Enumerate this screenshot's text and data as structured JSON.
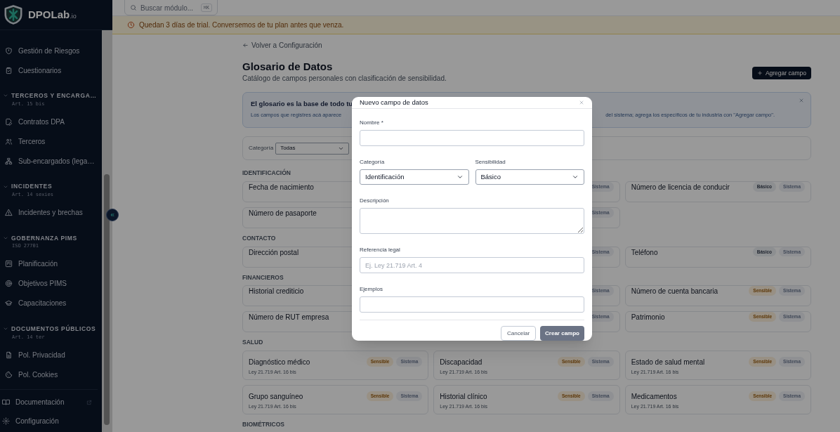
{
  "brand": {
    "name": "DPOLab",
    "suffix": ".io"
  },
  "search": {
    "placeholder": "Buscar módulo...",
    "shortcut": "⌘K"
  },
  "trial_banner": "Quedan 3 días de trial. Conversemos de tu plan antes que venza.",
  "sidebar": {
    "groups": [
      {
        "items": [
          "Gestión de Riesgos",
          "Cuestionarios"
        ]
      },
      {
        "title": "TERCEROS Y ENCARGA…",
        "subtitle": "Art. 15 bis",
        "expanded": true,
        "items": [
          "Contratos DPA",
          "Terceros",
          "Sub-encargados (lega…"
        ]
      },
      {
        "title": "INCIDENTES",
        "subtitle": "Art. 14 sexies",
        "expanded": true,
        "items": [
          "Incidentes y brechas"
        ]
      },
      {
        "title": "GOBERNANZA PIMS",
        "subtitle": "ISO 27701",
        "expanded": true,
        "items": [
          "Planificación",
          "Objetivos PIMS",
          "Capacitaciones"
        ]
      },
      {
        "title": "DOCUMENTOS PÚBLICOS",
        "subtitle": "Art. 14 ter",
        "expanded": true,
        "items": [
          "Pol. Privacidad",
          "Pol. Cookies"
        ]
      }
    ],
    "footer": [
      "Documentación",
      "Configuración"
    ]
  },
  "back_link": "Volver a Configuración",
  "page": {
    "title": "Glosario de Datos",
    "subtitle": "Catálogo de campos personales con clasificación de sensibilidad.",
    "add_button": "Agregar campo"
  },
  "info": {
    "title": "El glosario es la base de todo tu",
    "text_left": "Los campos que registres acá aparece",
    "text_right": "del sistema; agrega los específicos de tu industria con \"Agregar campo\"."
  },
  "filter": {
    "label": "Categoría",
    "value": "Todas"
  },
  "categories": [
    {
      "name": "IDENTIFICACIÓN",
      "cards": [
        {
          "title": "Fecha de nacimiento"
        },
        {
          "badges": [
            {
              "label": "Sistema",
              "kind": "system"
            }
          ]
        },
        {
          "title": "Número de licencia de conducir",
          "badges": [
            {
              "label": "Básico",
              "kind": "basic"
            },
            {
              "label": "Sistema",
              "kind": "system"
            }
          ]
        },
        {
          "title": "Número de pasaporte"
        },
        {
          "badges": [
            {
              "label": "Sistema",
              "kind": "system"
            }
          ]
        }
      ]
    },
    {
      "name": "CONTACTO",
      "cards": [
        {
          "title": "Dirección postal"
        },
        {
          "badges": [
            {
              "label": "Sistema",
              "kind": "system"
            }
          ]
        },
        {
          "title": "Teléfono",
          "badges": [
            {
              "label": "Básico",
              "kind": "basic"
            },
            {
              "label": "Sistema",
              "kind": "system"
            }
          ]
        }
      ]
    },
    {
      "name": "FINANCIEROS",
      "cards": [
        {
          "title": "Historial crediticio"
        },
        {
          "badges": [
            {
              "label": "Sistema",
              "kind": "system"
            }
          ]
        },
        {
          "title": "Número de cuenta bancaria",
          "badges": [
            {
              "label": "Sensible",
              "kind": "sensitive"
            },
            {
              "label": "Sistema",
              "kind": "system"
            }
          ]
        },
        {
          "title": "Número de RUT empresa"
        },
        {
          "badges": [
            {
              "label": "Sistema",
              "kind": "system"
            }
          ]
        },
        {
          "title": "Patrimonio",
          "badges": [
            {
              "label": "Sensible",
              "kind": "sensitive"
            },
            {
              "label": "Sistema",
              "kind": "system"
            }
          ]
        }
      ]
    },
    {
      "name": "SALUD",
      "cards": [
        {
          "title": "Diagnóstico médico",
          "legal": "Ley 21.719 Art. 16 bis",
          "badges": [
            {
              "label": "Sensible",
              "kind": "sensitive"
            },
            {
              "label": "Sistema",
              "kind": "system"
            }
          ]
        },
        {
          "title": "Discapacidad",
          "legal": "Ley 21.719 Art. 16 bis",
          "badges": [
            {
              "label": "Sensible",
              "kind": "sensitive"
            },
            {
              "label": "Sistema",
              "kind": "system"
            }
          ]
        },
        {
          "title": "Estado de salud mental",
          "legal": "Ley 21.719 Art. 16 bis",
          "badges": [
            {
              "label": "Sensible",
              "kind": "sensitive"
            },
            {
              "label": "Sistema",
              "kind": "system"
            }
          ]
        },
        {
          "title": "Grupo sanguíneo",
          "legal": "Ley 21.719 Art. 16 bis",
          "badges": [
            {
              "label": "Sensible",
              "kind": "sensitive"
            },
            {
              "label": "Sistema",
              "kind": "system"
            }
          ]
        },
        {
          "title": "Historial clínico",
          "legal": "Ley 21.719 Art. 16 bis",
          "badges": [
            {
              "label": "Sensible",
              "kind": "sensitive"
            },
            {
              "label": "Sistema",
              "kind": "system"
            }
          ]
        },
        {
          "title": "Medicamentos",
          "legal": "Ley 21.719 Art. 16 bis",
          "badges": [
            {
              "label": "Sensible",
              "kind": "sensitive"
            },
            {
              "label": "Sistema",
              "kind": "system"
            }
          ]
        }
      ]
    },
    {
      "name": "BIOMÉTRICOS"
    }
  ],
  "modal": {
    "title": "Nuevo campo de datos",
    "fields": [
      {
        "kind": "input",
        "label": "Nombre *"
      },
      {
        "kind": "selects",
        "items": [
          {
            "label": "Categoría",
            "value": "Identificación"
          },
          {
            "label": "Sensibilidad",
            "value": "Básico"
          }
        ]
      },
      {
        "kind": "textarea",
        "label": "Descripción"
      },
      {
        "kind": "input",
        "label": "Referencia legal",
        "placeholder": "Ej. Ley 21.719 Art. 4"
      },
      {
        "kind": "input",
        "label": "Ejemplos"
      }
    ],
    "cancel": "Cancelar",
    "submit": {
      "label": "Crear campo",
      "disabled": true
    }
  }
}
